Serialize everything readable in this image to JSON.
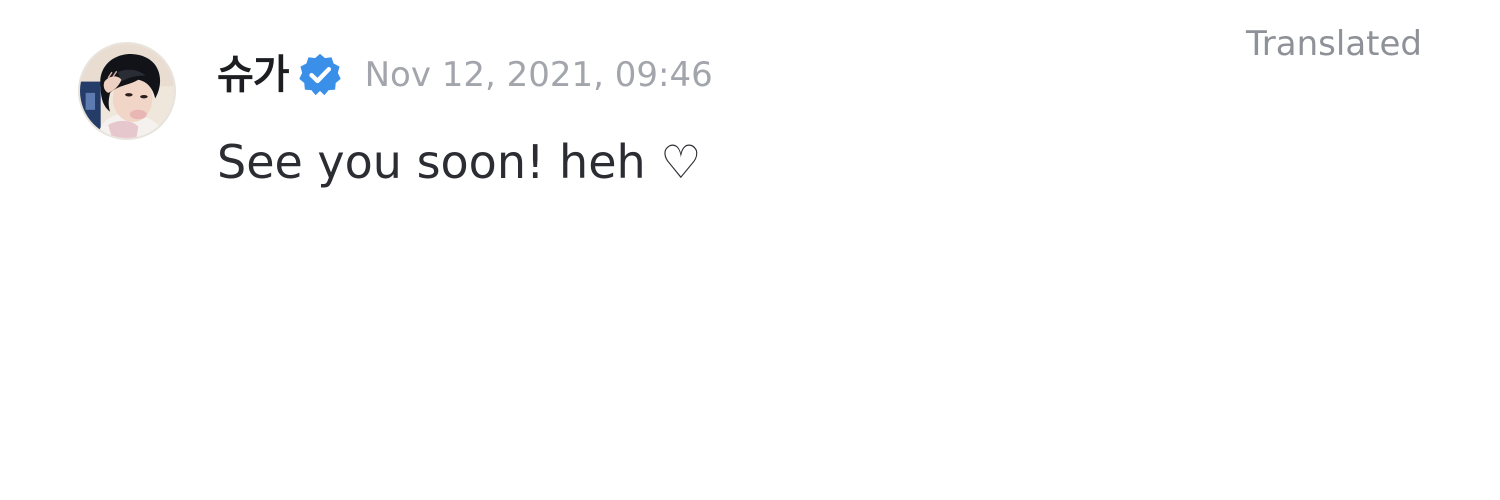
{
  "post": {
    "author": {
      "name": "슈가",
      "verified": true,
      "avatar_icon": "profile-photo-avatar",
      "badge_icon": "verified-badge-icon"
    },
    "timestamp": "Nov 12, 2021, 09:46",
    "translation_label": "Translated",
    "body": "See you soon! heh ♡"
  },
  "colors": {
    "background": "#ffffff",
    "name_text": "#1c1e21",
    "body_text": "#2b2d33",
    "timestamp_text": "#a2a5ab",
    "translated_text": "#8e9197",
    "verified_badge": "#3a8fe8"
  }
}
